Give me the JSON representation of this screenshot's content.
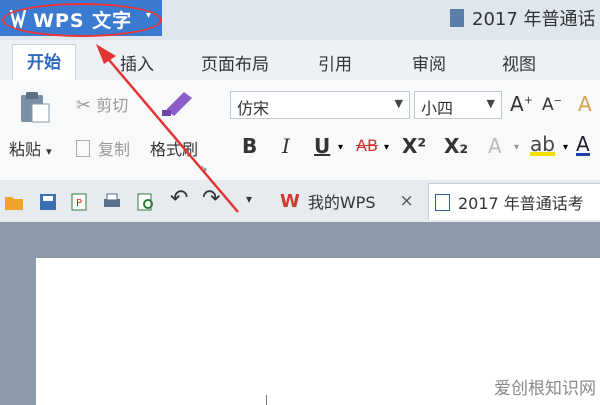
{
  "app_menu": {
    "name": "WPS 文字"
  },
  "document_title": "2017 年普通话",
  "ribbon_tabs": [
    "开始",
    "插入",
    "页面布局",
    "引用",
    "审阅",
    "视图"
  ],
  "clipboard": {
    "paste": "粘贴",
    "cut": "剪切",
    "copy": "复制",
    "format_painter": "格式刷"
  },
  "font": {
    "family": "仿宋",
    "size": "小四"
  },
  "format_buttons": {
    "bold": "B",
    "italic": "I",
    "underline": "U",
    "strikethrough": "AB",
    "superscript": "X²",
    "subscript": "X₂"
  },
  "doc_tabs": [
    {
      "label": "我的WPS",
      "close": "×"
    },
    {
      "label": "2017 年普通话考"
    }
  ],
  "watermark": "爱创根知识网",
  "colors": {
    "app_button": "#3a7bd1",
    "annotation": "#e33333",
    "active_tab_text": "#2b68c0"
  }
}
